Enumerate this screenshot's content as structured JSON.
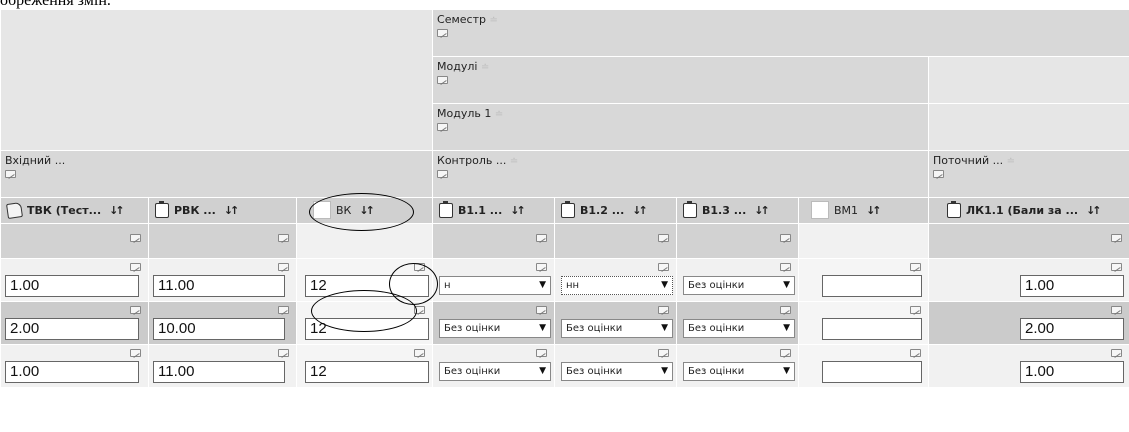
{
  "caption": "обреження змін.",
  "headers": {
    "semester": "Семестр",
    "modules": "Модулі",
    "module1": "Модуль 1",
    "incoming": "Вхідний ...",
    "control": "Контроль ...",
    "current": "Поточний ...",
    "hint": "≐"
  },
  "columns": [
    {
      "label": "ТВК (Тест...",
      "sort": "↓↑"
    },
    {
      "label": "РВК ...",
      "sort": "↓↑"
    },
    {
      "label": "ВК",
      "sort": "↓↑"
    },
    {
      "label": "В1.1 ...",
      "sort": "↓↑"
    },
    {
      "label": "В1.2 ...",
      "sort": "↓↑"
    },
    {
      "label": "В1.3 ...",
      "sort": "↓↑"
    },
    {
      "label": "ВМ1",
      "sort": "↓↑"
    },
    {
      "label": "ЛК1.1 (Бали за ...",
      "sort": "↓↑"
    }
  ],
  "rows": [
    {
      "tvk": "1.00",
      "rvk": "11.00",
      "vk": "12",
      "v11": "н",
      "v12": "нн",
      "v13": "Без оцінки",
      "vm1": "",
      "lk11": "1.00"
    },
    {
      "tvk": "2.00",
      "rvk": "10.00",
      "vk": "12",
      "v11": "Без оцінки",
      "v12": "Без оцінки",
      "v13": "Без оцінки",
      "vm1": "",
      "lk11": "2.00"
    },
    {
      "tvk": "1.00",
      "rvk": "11.00",
      "vk": "12",
      "v11": "Без оцінки",
      "v12": "Без оцінки",
      "v13": "Без оцінки",
      "vm1": "",
      "lk11": "1.00"
    }
  ]
}
